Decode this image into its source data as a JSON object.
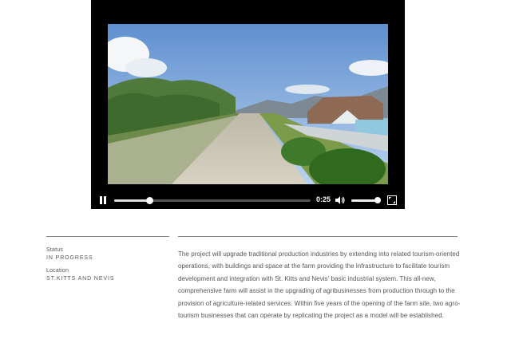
{
  "video_player": {
    "time": "0:25",
    "progress": 0.18,
    "volume": 0.88,
    "icons": [
      "pause-icon",
      "volume-icon",
      "fullscreen-icon"
    ]
  },
  "project": {
    "status_label": "Status",
    "status_value": "IN PROGRESS",
    "location_label": "Location",
    "location_value": "ST.KITTS AND NEVIS",
    "description": "The project will upgrade traditional production industries by extending into related tourism-oriented operations, with buildings and space at the farm providing the infrastructure to facilitate tourism development and integration with St. Kitts and Nevis' basic industrial system. This all-new, comprehensive farm will assist in the upgrading of agribusinesses from production through to the provision of agriculture-related services. Within five years of the opening of the farm site, two agro-tourism businesses that can operate by replicating the project as a model will be established."
  }
}
